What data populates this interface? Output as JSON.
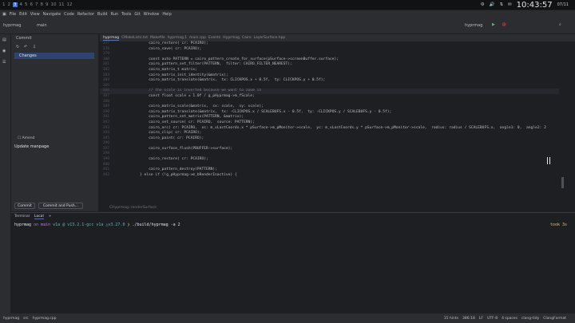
{
  "workspaces": [
    "1",
    "2",
    "3",
    "4",
    "5",
    "6",
    "7",
    "8",
    "9",
    "10",
    "11",
    "12"
  ],
  "active_workspace": "3",
  "clock": "10:43:57",
  "date": "07/11",
  "menu": [
    "File",
    "Edit",
    "View",
    "Navigate",
    "Code",
    "Refactor",
    "Build",
    "Run",
    "Tools",
    "Git",
    "Window",
    "Help"
  ],
  "project": "hyprmag",
  "branch": "main",
  "run_config": "hyprmag",
  "commit_panel": {
    "title": "Commit",
    "changes_label": "Changes",
    "amend_label": "Amend",
    "message": "Update manpage",
    "commit_button": "Commit",
    "commit_push_button": "Commit and Push..."
  },
  "editor_tabs": [
    "hyprmag",
    "CMakeLists.txt",
    "Makefile",
    "hyprmag.1",
    "main.cpp",
    "Events",
    "Hyprmag",
    "Cairo",
    "LayerSurface.hpp"
  ],
  "code_lines": [
    {
      "n": "377",
      "t": "    cairo_restore( cr: PCAIRO);"
    },
    {
      "n": "378",
      "t": "    cairo_save( cr: PCAIRO);"
    },
    {
      "n": "379",
      "t": ""
    },
    {
      "n": "380",
      "t": "    const auto PATTERN = cairo_pattern_create_for_surface(pSurface->screenBuffer.surface);"
    },
    {
      "n": "381",
      "t": "    cairo_pattern_set_filter(PATTERN,  filter: CAIRO_FILTER_NEAREST);"
    },
    {
      "n": "382",
      "t": "    cairo_matrix_t matrix;"
    },
    {
      "n": "383",
      "t": "    cairo_matrix_init_identity(&matrix);"
    },
    {
      "n": "384",
      "t": "    cairo_matrix_translate(&matrix,  tx: CLICKPOS.x + 0.5f,  ty: CLICKPOS.y + 0.5f);"
    },
    {
      "n": "385",
      "t": ""
    },
    {
      "n": "386",
      "t": "    // the scale is inverted because we want to zoom in"
    },
    {
      "n": "387",
      "t": "    const float scale = 1.0f / g_pHyprmag->m_fScale;"
    },
    {
      "n": "388",
      "t": ""
    },
    {
      "n": "389",
      "t": "    cairo_matrix_scale(&matrix,  sx: scale,  sy: scale);"
    },
    {
      "n": "390",
      "t": "    cairo_matrix_translate(&matrix,  tx: -CLICKPOS.x / SCALEBUFS.x - 0.5f,  ty: -CLICKPOS.y / SCALEBUFS.y - 0.5f);"
    },
    {
      "n": "391",
      "t": "    cairo_pattern_set_matrix(PATTERN, &matrix);"
    },
    {
      "n": "392",
      "t": "    cairo_set_source( cr: PCAIRO,  source: PATTERN);"
    },
    {
      "n": "393",
      "t": "    cairo_arc( cr: PCAIRO,  xc: m_vLastCoords.x * pSurface->m_pMonitor->scale,  yc: m_vLastCoords.y * pSurface->m_pMonitor->scale,  radius: radius / SCALEBUFS.x,  angle1: 0,  angle2: 2"
    },
    {
      "n": "394",
      "t": "    cairo_clip( cr: PCAIRO);"
    },
    {
      "n": "395",
      "t": "    cairo_paint( cr: PCAIRO);"
    },
    {
      "n": "396",
      "t": ""
    },
    {
      "n": "397",
      "t": "    cairo_surface_flush(PBUFFER->surface);"
    },
    {
      "n": "398",
      "t": ""
    },
    {
      "n": "399",
      "t": "    cairo_restore( cr: PCAIRO);"
    },
    {
      "n": "400",
      "t": ""
    },
    {
      "n": "401",
      "t": "    cairo_pattern_destroy(PATTERN);"
    },
    {
      "n": "402",
      "t": "} else if (!g_pHyprmag->m_bRenderInactive) {"
    }
  ],
  "breadcrumb": "CHyprmag::renderSurface",
  "terminal": {
    "tabs": [
      "Terminal",
      "Local"
    ],
    "prompt_dir": "hyprmag",
    "prompt_branch": "main",
    "prompt_info": "v1a @ v13.2.1-gcc v1a △v3.27.0",
    "command": "./build/hyprmag -a 2",
    "took": "took 3s"
  },
  "status": {
    "left": [
      "hyprmag",
      "src",
      "hyprmag.cpp"
    ],
    "right": [
      "15 hints",
      "386:18",
      "LF",
      "UTF-8",
      "4 spaces",
      "clang-tidy",
      "ClangFormat"
    ]
  }
}
